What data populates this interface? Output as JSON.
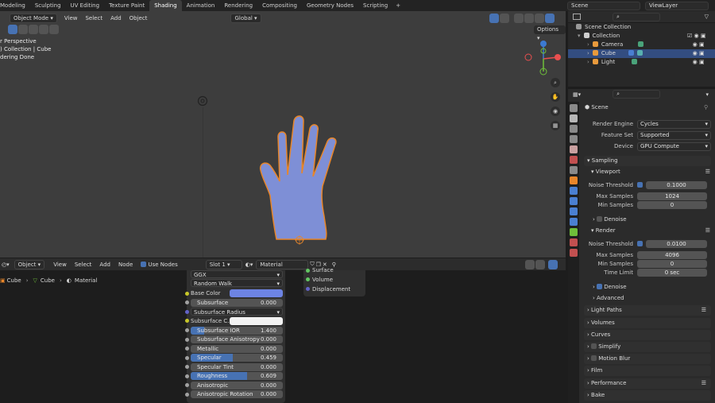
{
  "workspace_tabs": [
    "Modeling",
    "Sculpting",
    "UV Editing",
    "Texture Paint",
    "Shading",
    "Animation",
    "Rendering",
    "Compositing",
    "Geometry Nodes",
    "Scripting"
  ],
  "active_tab": "Shading",
  "add_workspace_label": "+",
  "scene_name": "Scene",
  "view_layer_name": "ViewLayer",
  "viewport": {
    "mode": "Object Mode",
    "menus": [
      "View",
      "Select",
      "Add",
      "Object"
    ],
    "transform_orientation": "Global",
    "overlay_lines": [
      "r Perspective",
      ") Collection | Cube",
      "dering Done"
    ]
  },
  "outliner": {
    "title": "Scene Collection",
    "items": [
      {
        "label": "Collection",
        "color": "#cfcfcf"
      },
      {
        "label": "Camera",
        "color": "#e89a3c"
      },
      {
        "label": "Cube",
        "color": "#e89a3c",
        "selected": true
      },
      {
        "label": "Light",
        "color": "#e89a3c"
      }
    ]
  },
  "properties": {
    "context": "Scene",
    "render_engine_label": "Render Engine",
    "render_engine": "Cycles",
    "feature_set_label": "Feature Set",
    "feature_set": "Supported",
    "device_label": "Device",
    "device": "GPU Compute",
    "sampling": "Sampling",
    "viewport": "Viewport",
    "vp_noise_label": "Noise Threshold",
    "vp_noise": "0.1000",
    "vp_max_label": "Max Samples",
    "vp_max": "1024",
    "vp_min_label": "Min Samples",
    "vp_min": "0",
    "vp_denoise": "Denoise",
    "render": "Render",
    "r_noise_label": "Noise Threshold",
    "r_noise": "0.0100",
    "r_max_label": "Max Samples",
    "r_max": "4096",
    "r_min_label": "Min Samples",
    "r_min": "0",
    "r_time_label": "Time Limit",
    "r_time": "0 sec",
    "r_denoise": "Denoise",
    "advanced": "Advanced",
    "sections": [
      "Light Paths",
      "Volumes",
      "Curves",
      "Simplify",
      "Motion Blur",
      "Film",
      "Performance",
      "Bake"
    ]
  },
  "node_header": {
    "mode": "Object",
    "menus": [
      "View",
      "Select",
      "Add",
      "Node"
    ],
    "use_nodes": "Use Nodes",
    "slot": "Slot 1",
    "material": "Material"
  },
  "breadcrumb": [
    "Cube",
    "Cube",
    "Material"
  ],
  "principled": {
    "distribution": "GGX",
    "subsurface_method": "Random Walk",
    "rows": [
      {
        "label": "Base Color",
        "type": "color",
        "color": "#6d84e4"
      },
      {
        "label": "Subsurface",
        "value": "0.000",
        "fill": 0
      },
      {
        "label": "Subsurface Radius",
        "type": "dropdown"
      },
      {
        "label": "Subsurface C...",
        "type": "color",
        "color": "#f2f2f2"
      },
      {
        "label": "Subsurface IOR",
        "value": "1.400",
        "fill": 0.15
      },
      {
        "label": "Subsurface Anisotropy",
        "value": "0.000",
        "fill": 0
      },
      {
        "label": "Metallic",
        "value": "0.000",
        "fill": 0
      },
      {
        "label": "Specular",
        "value": "0.459",
        "fill": 0.459
      },
      {
        "label": "Specular Tint",
        "value": "0.000",
        "fill": 0
      },
      {
        "label": "Roughness",
        "value": "0.609",
        "fill": 0.609
      },
      {
        "label": "Anisotropic",
        "value": "0.000",
        "fill": 0
      },
      {
        "label": "Anisotropic Rotation",
        "value": "0.000",
        "fill": 0
      }
    ]
  },
  "output_node": {
    "sockets": [
      "Surface",
      "Volume",
      "Displacement"
    ]
  },
  "options_label": "Options",
  "colors": {
    "accent": "#4772b3",
    "model": "#7e8fd6",
    "outline": "#e8862a"
  }
}
